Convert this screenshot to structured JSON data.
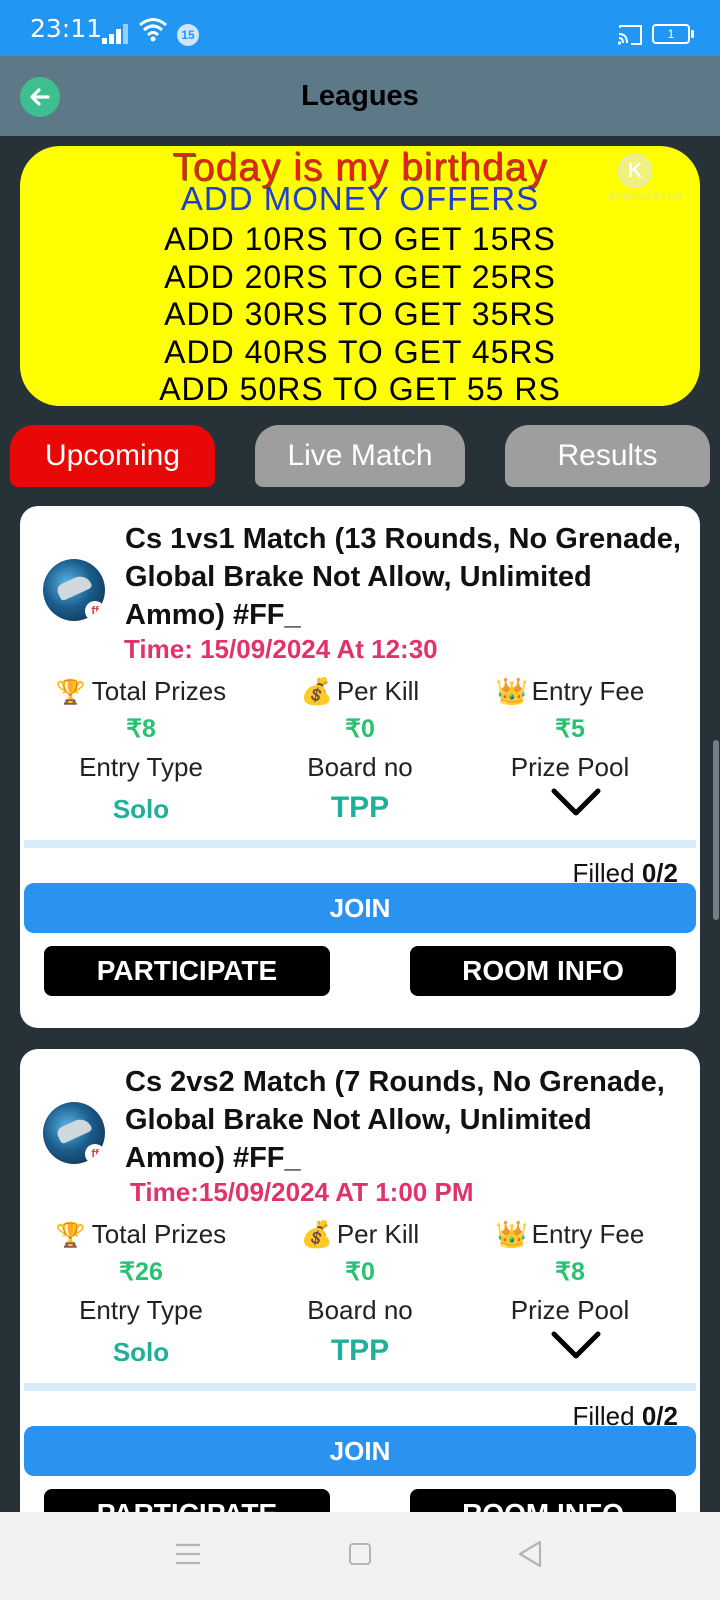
{
  "status_bar": {
    "time": "23:11",
    "notification_count": "15",
    "battery": "1"
  },
  "app_bar": {
    "title": "Leagues"
  },
  "banner": {
    "lines": [
      "Today is my birthday",
      "ADD MONEY OFFERS",
      "ADD 10RS TO GET 15RS",
      "ADD 20RS TO GET 25RS",
      "ADD 30RS TO GET 35RS",
      "ADD 40RS TO GET 45RS",
      "ADD 50RS TO GET 55 RS"
    ],
    "watermark_text": "KINEMASTER",
    "watermark_logo": "K"
  },
  "tabs": [
    {
      "label": "Upcoming",
      "active": true
    },
    {
      "label": "Live Match",
      "active": false
    },
    {
      "label": "Results",
      "active": false
    }
  ],
  "labels": {
    "total_prizes": "Total Prizes",
    "per_kill": "Per Kill",
    "entry_fee": "Entry Fee",
    "entry_type": "Entry Type",
    "board_no": "Board no",
    "prize_pool": "Prize Pool",
    "filled": "Filled",
    "join": "JOIN",
    "participate": "PARTICIPATE",
    "room_info": "ROOM INFO"
  },
  "matches": [
    {
      "title": "Cs 1vs1 Match (13 Rounds, No Grenade, Global Brake Not Allow, Unlimited Ammo)   #FF_",
      "time": "Time: 15/09/2024 At 12:30",
      "total_prizes": "₹8",
      "per_kill": "₹0",
      "entry_fee": "₹5",
      "entry_type": "Solo",
      "board_no": "TPP",
      "filled_count": "0/2"
    },
    {
      "title": "Cs 2vs2 Match (7 Rounds, No Grenade, Global Brake Not Allow, Unlimited Ammo)   #FF_",
      "time": "Time:15/09/2024 AT 1:00 PM",
      "total_prizes": "₹26",
      "per_kill": "₹0",
      "entry_fee": "₹8",
      "entry_type": "Solo",
      "board_no": "TPP",
      "filled_count": "0/2"
    }
  ],
  "colors": {
    "status_bar": "#2196f3",
    "app_bar": "#5d7987",
    "background": "#263238",
    "banner": "#ffff00",
    "tab_active": "#e80808",
    "tab_inactive": "#9e9e9e",
    "time_text": "#e0336b",
    "value_green": "#2ac170",
    "join_button": "#2a93ef"
  }
}
